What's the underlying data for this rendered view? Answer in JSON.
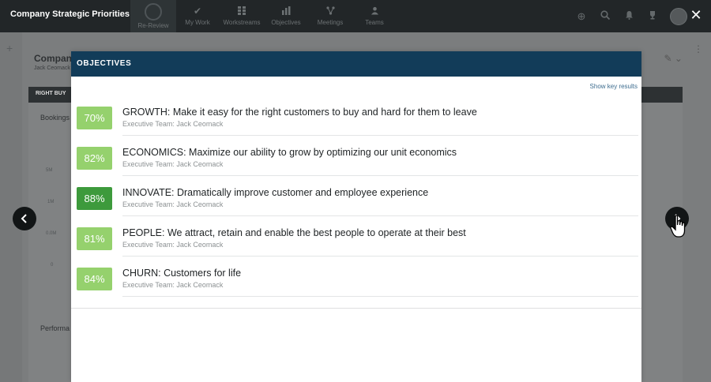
{
  "app": {
    "title": "Company Strategic Priorities"
  },
  "nav": [
    {
      "label": "Re-Review",
      "icon": "circle-icon"
    },
    {
      "label": "My Work",
      "icon": "check-icon"
    },
    {
      "label": "Workstreams",
      "icon": "grid-icon"
    },
    {
      "label": "Objectives",
      "icon": "bar-chart-icon"
    },
    {
      "label": "Meetings",
      "icon": "network-icon"
    },
    {
      "label": "Teams",
      "icon": "people-icon"
    }
  ],
  "background": {
    "page_title": "Company",
    "page_subtitle": "Jack Ceomack",
    "band_label": "RIGHT BUY",
    "bookings": "Bookings",
    "performance": "Performa",
    "ticks": [
      "5M",
      "1M",
      "0.0M",
      "0"
    ]
  },
  "modal": {
    "header": "OBJECTIVES",
    "show_key_results": "Show key results",
    "objectives": [
      {
        "percent": "70%",
        "title": "GROWTH: Make it easy for the right customers to buy and hard for them to leave",
        "owner": "Executive Team: Jack Ceomack",
        "progress": 0.7
      },
      {
        "percent": "82%",
        "title": "ECONOMICS: Maximize our ability to grow by optimizing our unit economics",
        "owner": "Executive Team: Jack Ceomack",
        "progress": 0.82
      },
      {
        "percent": "88%",
        "title": "INNOVATE: Dramatically improve customer and employee experience",
        "owner": "Executive Team: Jack Ceomack",
        "progress": 0.88
      },
      {
        "percent": "81%",
        "title": "PEOPLE: We attract, retain and enable the best people to operate at their best",
        "owner": "Executive Team: Jack Ceomack",
        "progress": 0.81
      },
      {
        "percent": "84%",
        "title": "CHURN: Customers for life",
        "owner": "Executive Team: Jack Ceomack",
        "progress": 0.84
      }
    ]
  },
  "colors": {
    "header_bg": "#123c59",
    "pct_light": "#95d16d",
    "pct_dark": "#3d9a3c",
    "topbar_bg": "#222628",
    "link": "#3e6d8f"
  }
}
